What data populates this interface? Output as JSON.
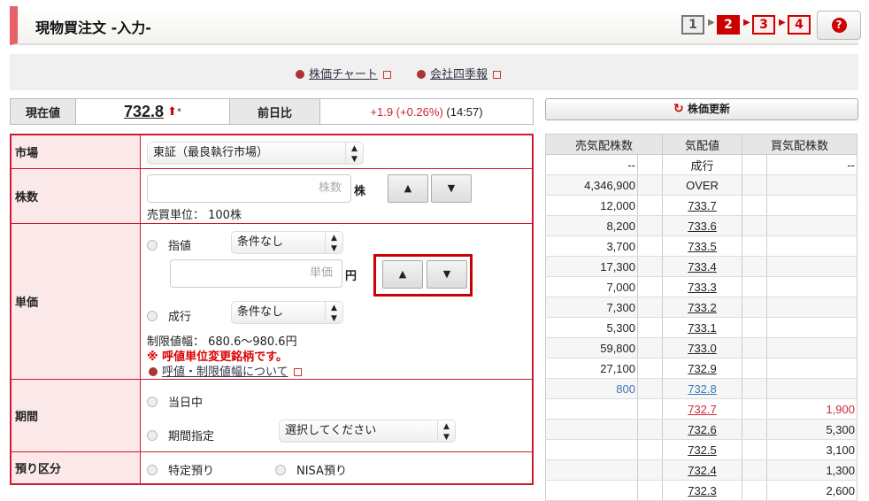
{
  "header": {
    "title": "現物買注文 -入力-",
    "steps": [
      "1",
      "2",
      "3",
      "4"
    ],
    "current_step": 2,
    "help_icon": "question-icon"
  },
  "links": [
    {
      "label": "株価チャート"
    },
    {
      "label": "会社四季報"
    }
  ],
  "price": {
    "current_label": "現在値",
    "current_value": "732.8",
    "asterisk": "*",
    "change_label": "前日比",
    "change_value": "+1.9 (+0.26%)",
    "time": "(14:57)",
    "up_color": "#cc0000"
  },
  "refresh_label": "株価更新",
  "form": {
    "market": {
      "label": "市場",
      "value": "東証（最良執行市場）"
    },
    "shares": {
      "label": "株数",
      "placeholder": "株数",
      "unit": "株",
      "lot": "売買単位： 100株"
    },
    "price": {
      "label": "単価",
      "limit_label": "指値",
      "limit_cond": "条件なし",
      "placeholder": "単価",
      "unit": "円",
      "market_label": "成行",
      "market_cond": "条件なし",
      "range": "制限値幅： 680.6〜980.6円",
      "warning": "※ 呼値単位変更銘柄です。",
      "link": "呼値・制限値幅について"
    },
    "period": {
      "label": "期間",
      "today": "当日中",
      "specify": "期間指定",
      "select": "選択してください"
    },
    "account": {
      "label": "預り区分",
      "specific": "特定預り",
      "nisa": "NISA預り"
    }
  },
  "board": {
    "headers": [
      "売気配株数",
      "気配値",
      "買気配株数"
    ],
    "rows": [
      {
        "sell": "--",
        "price": "成行",
        "buy": "--"
      },
      {
        "sell": "4,346,900",
        "price": "OVER",
        "buy": ""
      },
      {
        "sell": "12,000",
        "price": "733.7",
        "buy": ""
      },
      {
        "sell": "8,200",
        "price": "733.6",
        "buy": ""
      },
      {
        "sell": "3,700",
        "price": "733.5",
        "buy": ""
      },
      {
        "sell": "17,300",
        "price": "733.4",
        "buy": ""
      },
      {
        "sell": "7,000",
        "price": "733.3",
        "buy": ""
      },
      {
        "sell": "7,300",
        "price": "733.2",
        "buy": ""
      },
      {
        "sell": "5,300",
        "price": "733.1",
        "buy": ""
      },
      {
        "sell": "59,800",
        "price": "733.0",
        "buy": ""
      },
      {
        "sell": "27,100",
        "price": "732.9",
        "buy": ""
      },
      {
        "sell": "800",
        "price": "732.8",
        "buy": "",
        "color": "#3a7ab8"
      },
      {
        "sell": "",
        "price": "732.7",
        "buy": "1,900",
        "color": "#d0283c"
      },
      {
        "sell": "",
        "price": "732.6",
        "buy": "5,300"
      },
      {
        "sell": "",
        "price": "732.5",
        "buy": "3,100"
      },
      {
        "sell": "",
        "price": "732.4",
        "buy": "1,300"
      },
      {
        "sell": "",
        "price": "732.3",
        "buy": "2,600"
      }
    ]
  }
}
